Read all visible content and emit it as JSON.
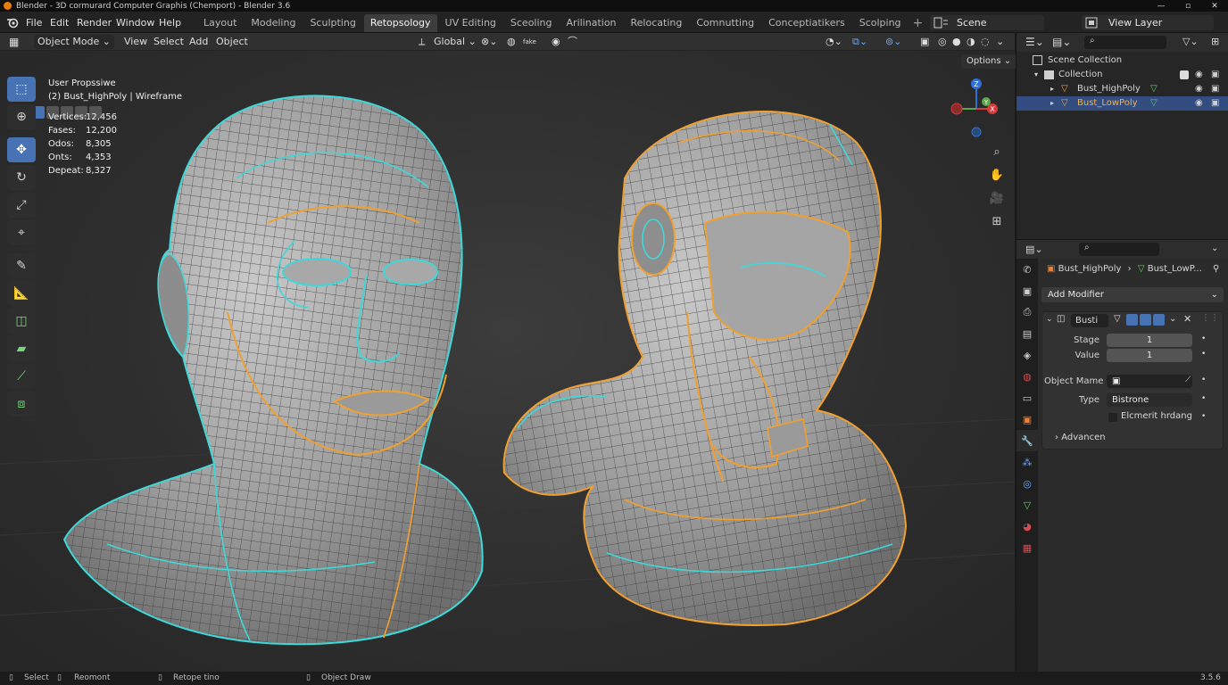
{
  "window": {
    "title": "Blender - 3D cormurard Computer Graphis (Chemport) - Blender 3.6",
    "controls": [
      "—",
      "▫",
      "✕"
    ]
  },
  "menu": [
    "File",
    "Edit",
    "Render",
    "Window",
    "Help"
  ],
  "workspaces": {
    "tabs": [
      "Layout",
      "Modeling",
      "Sculpting",
      "Retopsology",
      "UV Editing",
      "Sceoling",
      "Arilination",
      "Relocating",
      "Comnutting",
      "Conceptiatikers",
      "Scolping"
    ],
    "active_index": 3,
    "add": "+"
  },
  "scene": {
    "label": "Scene",
    "view_layer": "View Layer"
  },
  "viewport_header": {
    "mode": "Object Mode",
    "menus": [
      "View",
      "Select",
      "Add",
      "Object"
    ],
    "orientation": "Global",
    "snap_label": "fake",
    "options": "Options"
  },
  "overlay": {
    "view_name": "User Propssiwe",
    "object_info": "(2) Bust_HighPoly | Wireframe",
    "stats": [
      {
        "label": "Vertices:",
        "value": "12,456"
      },
      {
        "label": "Fases:",
        "value": "12,200"
      },
      {
        "label": "Odos:",
        "value": "8,305"
      },
      {
        "label": "Onts:",
        "value": "4,353"
      },
      {
        "label": "Depeat:",
        "value": "8,327"
      }
    ]
  },
  "gizmo": {
    "z": "Z",
    "y": "Y",
    "x": "X"
  },
  "outliner": {
    "root": "Scene Collection",
    "collection": "Collection",
    "objects": [
      {
        "name": "Bust_HighPoly",
        "selected": false
      },
      {
        "name": "Bust_LowPoly",
        "selected": true
      }
    ]
  },
  "properties": {
    "breadcrumb_object": "Bust_HighPoly",
    "breadcrumb_data": "Bust_LowP...",
    "add_modifier": "Add Modifier",
    "modifier": {
      "name": "Busti",
      "fields": [
        {
          "label": "Stage",
          "value": "1"
        },
        {
          "label": "Value",
          "value": "1"
        }
      ],
      "object_label": "Object Mame",
      "type_label": "Type",
      "type_value": "Bistrone",
      "checkbox_label": "Elcmerit hrdang",
      "advanced": "Advancen"
    }
  },
  "statusbar": {
    "items": [
      "Select",
      "Reomont",
      "Retope tino",
      "Object Draw"
    ],
    "version": "3.5.6"
  },
  "colors": {
    "accent": "#4772b3",
    "retopo_cyan": "#3fd8d8",
    "retopo_orange": "#f0a030",
    "blender_orange": "#e87d0d"
  }
}
